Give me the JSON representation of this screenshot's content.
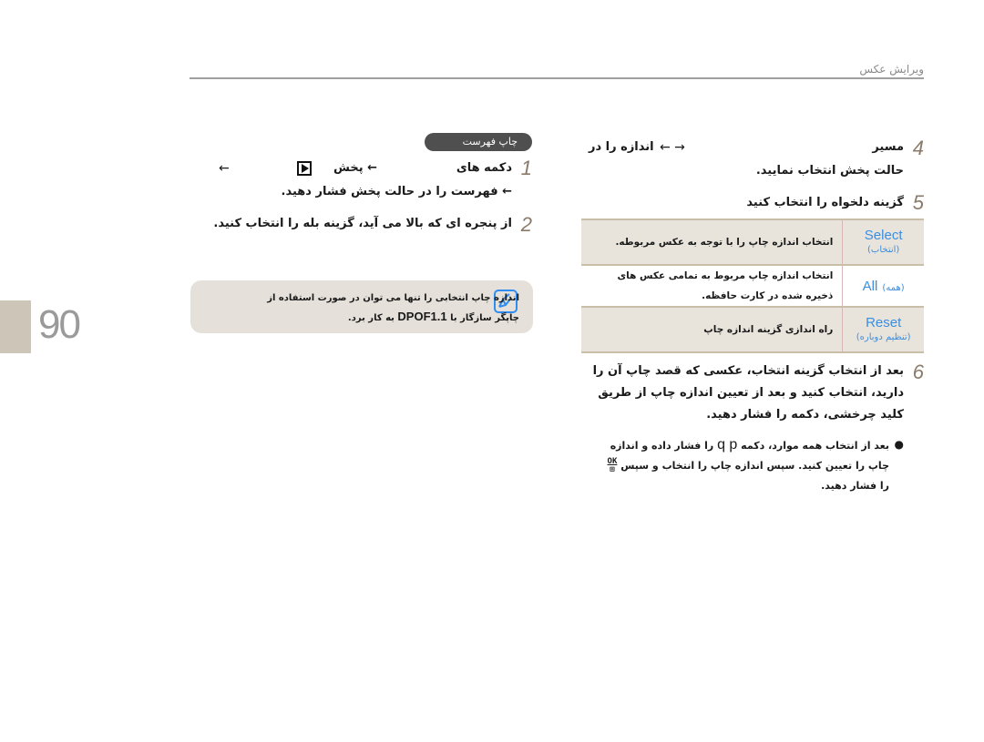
{
  "header": {
    "title": "ویرایش عکس"
  },
  "page": {
    "number": "90"
  },
  "right_column": {
    "step4": {
      "number": "4",
      "line1": "مسیر",
      "arrows": "← →",
      "line1_tail": "اندازه را در",
      "line2": "حالت پخش انتخاب نمایید."
    },
    "step5": {
      "number": "5",
      "text": "گزینه دلخواه را انتخاب کنید"
    },
    "options_table": [
      {
        "option": "Select",
        "option_fa": "(انتخاب)",
        "description": "انتخاب اندازه چاپ را با توجه به عکس مربوطه."
      },
      {
        "option": "All",
        "option_fa": "(همه)",
        "description": "انتخاب اندازه چاپ مربوط به تمامی عکس های ذخیره شده در کارت حافظه."
      },
      {
        "option": "Reset",
        "option_fa": "(تنظیم دوباره)",
        "description": "راه اندازی گزینه اندازه چاپ"
      }
    ],
    "step6": {
      "number": "6",
      "text": "بعد از انتخاب گزینه          انتخاب، عکسی که قصد چاپ آن را دارید، انتخاب کنید و بعد از تعیین اندازه چاپ از طریق کلید چرخشی، دکمه  را فشار دهید."
    },
    "bullet": {
      "text_a": "بعد از انتخاب همه موارد، دکمه",
      "keys": "q p",
      "text_b": "را فشار داده و اندازه چاپ را تعیین کنید. سپس اندازه چاپ را انتخاب و سپس",
      "ok_label": "OK",
      "text_c": "را فشار دهید."
    }
  },
  "left_column": {
    "section_pill": "چاپ فهرست",
    "step1": {
      "number": "1",
      "line1_a": "دکمه های",
      "line1_b": "← پخش",
      "line1_arrow": "←",
      "line2": "← فهرست را در حالت پخش فشار دهید."
    },
    "step2": {
      "number": "2",
      "text": "از پنجره ای که بالا می آید، گزینه          بله را انتخاب کنید."
    },
    "note": {
      "text_a": "اندازه چاپ انتخابی را تنها می توان در صورت استفاده از چاپگر سازگار با",
      "dpof": "DPOF1.1",
      "text_b": "به کار برد."
    }
  },
  "colors": {
    "option_blue": "#3b8ee0",
    "row_shade": "#e8e4dc",
    "note_bg": "#e5e1da",
    "pill_bg": "#4f4f4f",
    "page_tab": "#cdc6b8",
    "step_number": "#8a7a6a"
  }
}
